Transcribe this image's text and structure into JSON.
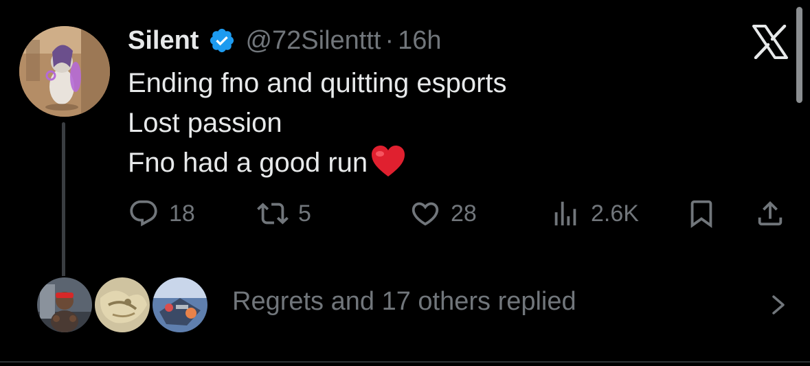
{
  "tweet": {
    "author": {
      "display_name": "Silent",
      "handle": "@72Silenttt",
      "separator": "·",
      "time": "16h"
    },
    "text_lines": [
      "Ending fno and quitting esports",
      "Lost passion",
      "Fno had a good run"
    ],
    "actions": {
      "replies": "18",
      "reposts": "5",
      "likes": "28",
      "views": "2.6K"
    }
  },
  "replied_summary": "Regrets and 17 others replied",
  "icons": {
    "verified": "verified-badge-icon",
    "close": "x-logo-icon",
    "reply": "reply-bubble-icon",
    "repost": "repost-icon",
    "like": "heart-icon",
    "views": "views-bar-icon",
    "bookmark": "bookmark-icon",
    "share": "share-icon",
    "chevron": "chevron-right-icon",
    "emoji": "red-heart-emoji"
  },
  "colors": {
    "background": "#000000",
    "text_primary": "#e7e9ea",
    "text_secondary": "#71767b",
    "verified_blue": "#1d9bf0",
    "emoji_red": "#e0202f"
  }
}
